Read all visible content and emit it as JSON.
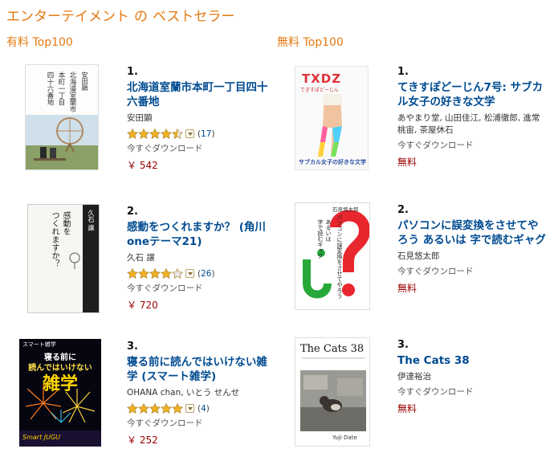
{
  "page": {
    "title_main": "エンターテイメント",
    "title_of": "の",
    "title_rest": "ベストセラー"
  },
  "paid": {
    "heading": "有料 Top100",
    "items": [
      {
        "rank": "1.",
        "title": "北海道室蘭市本町一丁目四十六番地",
        "author": "安田顕",
        "rating": 4.5,
        "review_count": "17",
        "availability": "今すぐダウンロード",
        "price": "￥ 542",
        "cover_text": [
          "安田顕",
          "北海道室蘭市",
          "本町一丁目",
          "四十六番地"
        ]
      },
      {
        "rank": "2.",
        "title": "感動をつくれますか？ (角川oneテーマ21)",
        "author": "久石 譲",
        "rating": 4,
        "review_count": "26",
        "availability": "今すぐダウンロード",
        "price": "￥ 720",
        "cover_text": [
          "感動を",
          "つくれますか？",
          "久石 譲"
        ]
      },
      {
        "rank": "3.",
        "title": "寝る前に読んではいけない雑学 (スマート雑学)",
        "author": "OHANA chan, いとう せんせ",
        "rating": 5,
        "review_count": "4",
        "availability": "今すぐダウンロード",
        "price": "￥ 252",
        "cover_text": [
          "スマート雑学",
          "寝る前に",
          "読んではいけない",
          "雑学",
          "Smart JUGU"
        ]
      }
    ]
  },
  "free": {
    "heading": "無料 Top100",
    "items": [
      {
        "rank": "1.",
        "title": "てきすぽどーじん7号: サブカル女子の好きな文学",
        "author": "あやまり堂, 山田佳江, 松浦徹郎, 進常桃宙, 茶屋休石",
        "availability": "今すぐダウンロード",
        "price": "無料",
        "cover_text": [
          "TXDZ",
          "てきすぽどーじん",
          "サブカル女子の好きな文学"
        ]
      },
      {
        "rank": "2.",
        "title": "パソコンに誤変換をさせてやろう あるいは 字で読むギャグ",
        "author": "石見悠太郎",
        "availability": "今すぐダウンロード",
        "price": "無料",
        "cover_text": [
          "石見悠太郎",
          "パソコンに誤変換をさせてやろう",
          "あるいは",
          "字で読むギャグ"
        ]
      },
      {
        "rank": "3.",
        "title": "The Cats 38",
        "author": "伊達裕治",
        "availability": "今すぐダウンロード",
        "price": "無料",
        "cover_text": [
          "The Cats 38",
          "Yuji Date"
        ]
      }
    ]
  },
  "colors": {
    "accent_orange": "#e47911",
    "link_blue": "#004b91",
    "price_red": "#990000",
    "star_gold": "#f0b020"
  }
}
